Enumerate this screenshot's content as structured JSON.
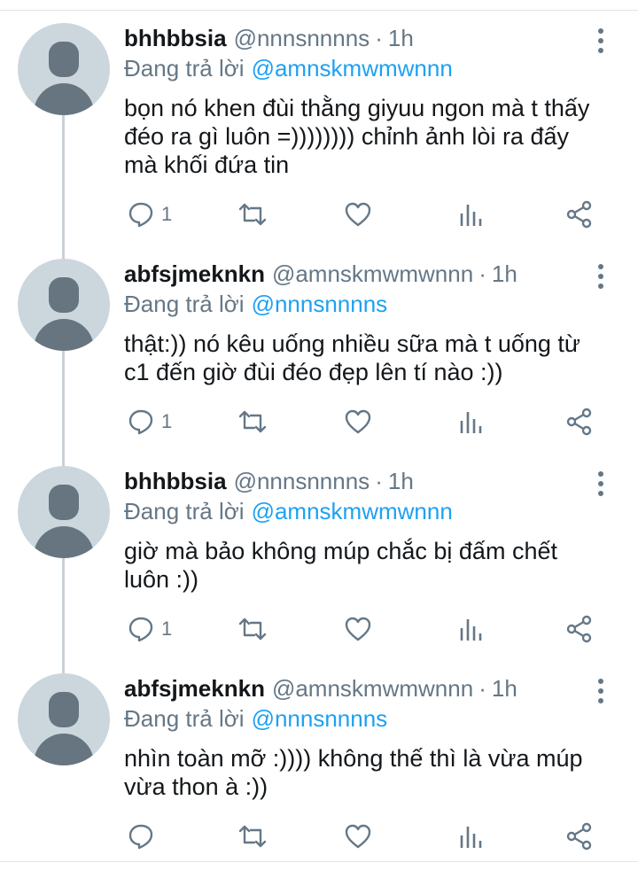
{
  "tweets": [
    {
      "name": "bhhbbsia",
      "handle": "@nnnsnnnns",
      "time": "1h",
      "reply_prefix": "Đang trả lời",
      "reply_to": "@amnskmwmwnnn",
      "text": "bọn nó khen đùi thằng giyuu ngon mà t thấy\nđéo ra gì luôn =)))))))) chỉnh ảnh lòi ra đấy\nmà khối đứa tin",
      "reply_count": "1"
    },
    {
      "name": "abfsjmeknkn",
      "handle": "@amnskmwmwnnn",
      "time": "1h",
      "reply_prefix": "Đang trả lời",
      "reply_to": "@nnnsnnnns",
      "text": "thật:)) nó kêu uống nhiều sữa mà t uống từ\nc1 đến giờ đùi đéo đẹp lên tí nào :))",
      "reply_count": "1"
    },
    {
      "name": "bhhbbsia",
      "handle": "@nnnsnnnns",
      "time": "1h",
      "reply_prefix": "Đang trả lời",
      "reply_to": "@amnskmwmwnnn",
      "text": "giờ mà bảo không múp chắc bị đấm chết\nluôn :))",
      "reply_count": "1"
    },
    {
      "name": "abfsjmeknkn",
      "handle": "@amnskmwmwnnn",
      "time": "1h",
      "reply_prefix": "Đang trả lời",
      "reply_to": "@nnnsnnnns",
      "text": "nhìn toàn mỡ :)))) không thế thì là vừa múp\nvừa thon à :))",
      "reply_count": ""
    }
  ],
  "separator": "·",
  "icons": {
    "reply": "reply-icon",
    "retweet": "retweet-icon",
    "like": "like-icon",
    "analytics": "analytics-icon",
    "share": "share-icon",
    "menu": "more-vertical-icon"
  },
  "colors": {
    "mention": "#1da1f2",
    "muted": "#657786",
    "avatar_bg": "#ccd6dd",
    "thread_line": "#c9d1d8"
  }
}
